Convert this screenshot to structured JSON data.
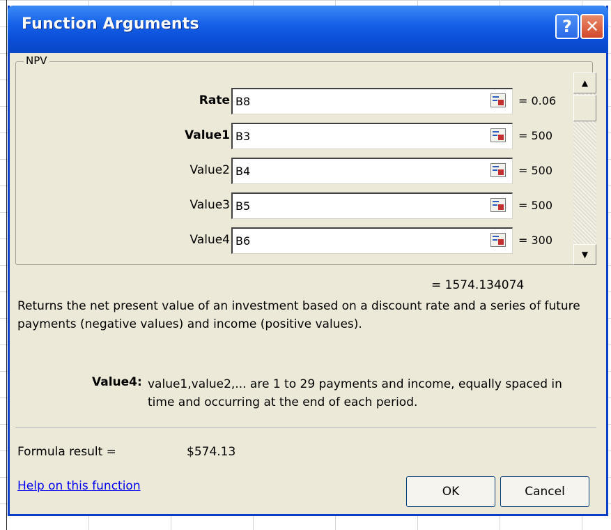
{
  "dialog": {
    "title": "Function Arguments",
    "help_button": "?",
    "close_button": "✕"
  },
  "function_group": {
    "name": "NPV",
    "arguments": [
      {
        "label": "Rate",
        "value": "B8",
        "result": "= 0.06",
        "bold": true
      },
      {
        "label": "Value1",
        "value": "B3",
        "result": "= 500",
        "bold": true
      },
      {
        "label": "Value2",
        "value": "B4",
        "result": "= 500",
        "bold": false
      },
      {
        "label": "Value3",
        "value": "B5",
        "result": "= 500",
        "bold": false
      },
      {
        "label": "Value4",
        "value": "B6",
        "result": "= 300",
        "bold": false
      }
    ]
  },
  "result_line": "= 1574.134074",
  "description": "Returns the net present value of an investment based on a discount rate and a series of future payments (negative values) and income (positive values).",
  "parameter_help": {
    "name": "Value4:",
    "text": "value1,value2,... are 1 to 29 payments and income, equally spaced in time and occurring at the end of each period."
  },
  "formula": {
    "label": "Formula result =",
    "value": "$574.13"
  },
  "help_link": "Help on this function",
  "buttons": {
    "ok": "OK",
    "cancel": "Cancel"
  },
  "scrollbar": {
    "up_icon": "scroll-up-arrow",
    "down_icon": "scroll-down-arrow"
  }
}
